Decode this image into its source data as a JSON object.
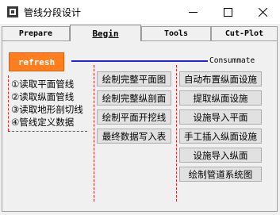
{
  "window": {
    "title": "管线分段设计"
  },
  "tabs": [
    {
      "label": "Prepare"
    },
    {
      "label": "Begin"
    },
    {
      "label": "Tools"
    },
    {
      "label": "Cut-Plot"
    }
  ],
  "refresh_label": "refresh",
  "consummate_label": "Consummate",
  "steps": [
    "①读取平面管线",
    "②读取纵面管线",
    "③读取地形剖切线",
    "④管线定义数据"
  ],
  "middle_buttons": [
    "绘制完整平面图",
    "绘制完整纵剖面",
    "绘制平面开挖线",
    "最终数据写入表"
  ],
  "right_buttons": [
    "自动布置纵面设施",
    "提取纵面设施",
    "设施导入平面",
    "手工插入纵面设施",
    "设施导入纵面",
    "绘制管道系统图"
  ],
  "colors": {
    "accent": "#ff7f1e",
    "line": "#2323e6",
    "dashed": "#e02020"
  }
}
